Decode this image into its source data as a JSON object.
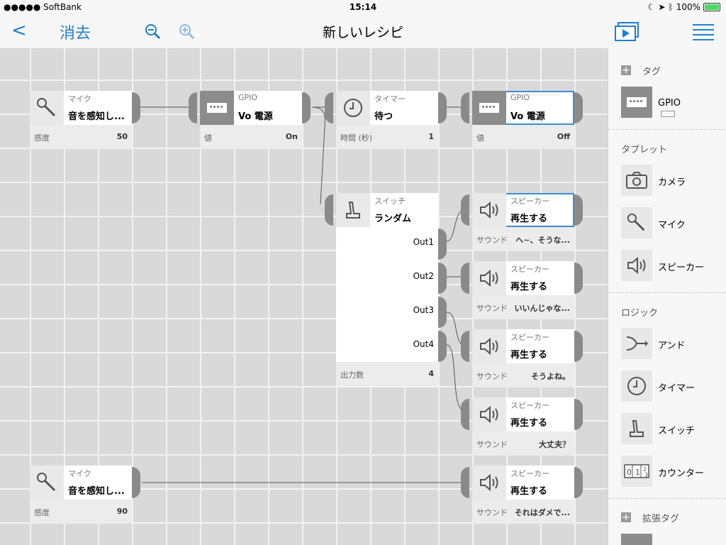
{
  "status": {
    "carrier": "SoftBank",
    "time": "15:14",
    "battery": "100%"
  },
  "nav": {
    "back_label": "<",
    "clear_label": "消去",
    "title": "新しいレシピ"
  },
  "canvas": {
    "nodes": {
      "mic1": {
        "category": "マイク",
        "name": "音を感知し...",
        "foot_label": "感度",
        "foot_value": "50"
      },
      "gpio1": {
        "category": "GPIO",
        "name": "Vo 電源",
        "foot_label": "値",
        "foot_value": "On"
      },
      "timer": {
        "category": "タイマー",
        "name": "待つ",
        "foot_label": "時間 (秒)",
        "foot_value": "1"
      },
      "gpio2": {
        "category": "GPIO",
        "name": "Vo 電源",
        "foot_label": "値",
        "foot_value": "Off"
      },
      "switch": {
        "category": "スイッチ",
        "name": "ランダム",
        "foot_label": "出力数",
        "foot_value": "4",
        "outputs": [
          "Out1",
          "Out2",
          "Out3",
          "Out4"
        ]
      },
      "sp1": {
        "category": "スピーカー",
        "name": "再生する",
        "foot_label": "サウンド",
        "foot_value": "へ~、そうな..."
      },
      "sp2": {
        "category": "スピーカー",
        "name": "再生する",
        "foot_label": "サウンド",
        "foot_value": "いいんじゃな..."
      },
      "sp3": {
        "category": "スピーカー",
        "name": "再生する",
        "foot_label": "サウンド",
        "foot_value": "そうよね。"
      },
      "sp4": {
        "category": "スピーカー",
        "name": "再生する",
        "foot_label": "サウンド",
        "foot_value": "大丈夫？"
      },
      "mic2": {
        "category": "マイク",
        "name": "音を感知し...",
        "foot_label": "感度",
        "foot_value": "90"
      },
      "sp5": {
        "category": "スピーカー",
        "name": "再生する",
        "foot_label": "サウンド",
        "foot_value": "それはダメで..."
      }
    }
  },
  "sidebar": {
    "tag_section": "タグ",
    "tag_items": [
      {
        "label": "GPIO",
        "icon": "gpio-icon"
      }
    ],
    "tablet_section": "タブレット",
    "tablet_items": [
      {
        "label": "カメラ",
        "icon": "camera-icon"
      },
      {
        "label": "マイク",
        "icon": "microphone-icon"
      },
      {
        "label": "スピーカー",
        "icon": "speaker-icon"
      }
    ],
    "logic_section": "ロジック",
    "logic_items": [
      {
        "label": "アンド",
        "icon": "and-icon"
      },
      {
        "label": "タイマー",
        "icon": "timer-icon"
      },
      {
        "label": "スイッチ",
        "icon": "switch-icon"
      },
      {
        "label": "カウンター",
        "icon": "counter-icon"
      }
    ],
    "ext_section": "拡張タグ"
  },
  "colors": {
    "accent": "#1e7fd6",
    "port": "#8a8a8a",
    "selected": "#3a8ed8"
  }
}
